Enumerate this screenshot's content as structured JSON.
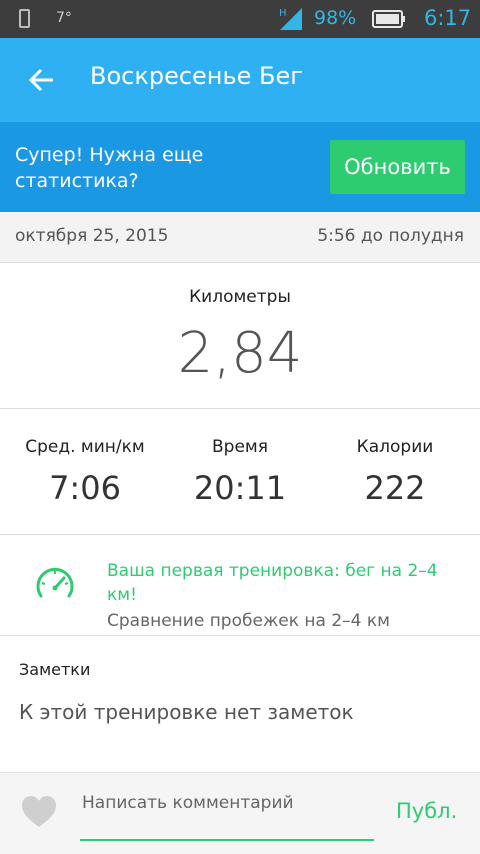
{
  "status_bar": {
    "temperature": "7°",
    "battery_percent": "98%",
    "time": "6:17",
    "network_label": "H",
    "icons": [
      "phone-icon",
      "signal-icon",
      "battery-icon"
    ],
    "accent_color": "#33b5e5"
  },
  "app_bar": {
    "title": "Воскресенье Бег",
    "back_icon": "arrow-left-icon",
    "background_color": "#2fb0f3"
  },
  "promo": {
    "text": "Супер! Нужна еще статистика?",
    "button_label": "Обновить",
    "background_color": "#1a98e3",
    "button_color": "#2ecc71"
  },
  "workout": {
    "date": "октября 25, 2015",
    "time": "5:56 до полудня",
    "distance_label": "Километры",
    "distance_value": "2,84",
    "stats": [
      {
        "label": "Сред. мин/км",
        "value": "7:06"
      },
      {
        "label": "Время",
        "value": "20:11"
      },
      {
        "label": "Калории",
        "value": "222"
      }
    ]
  },
  "achievement": {
    "icon": "speedometer-icon",
    "title": "Ваша первая тренировка: бег на 2–4 км!",
    "subtitle": "Сравнение пробежек на 2–4 км"
  },
  "notes": {
    "label": "Заметки",
    "empty_text": "К этой тренировке нет заметок"
  },
  "comment": {
    "like_icon": "heart-icon",
    "placeholder": "Написать комментарий",
    "publish_label": "Публ."
  }
}
